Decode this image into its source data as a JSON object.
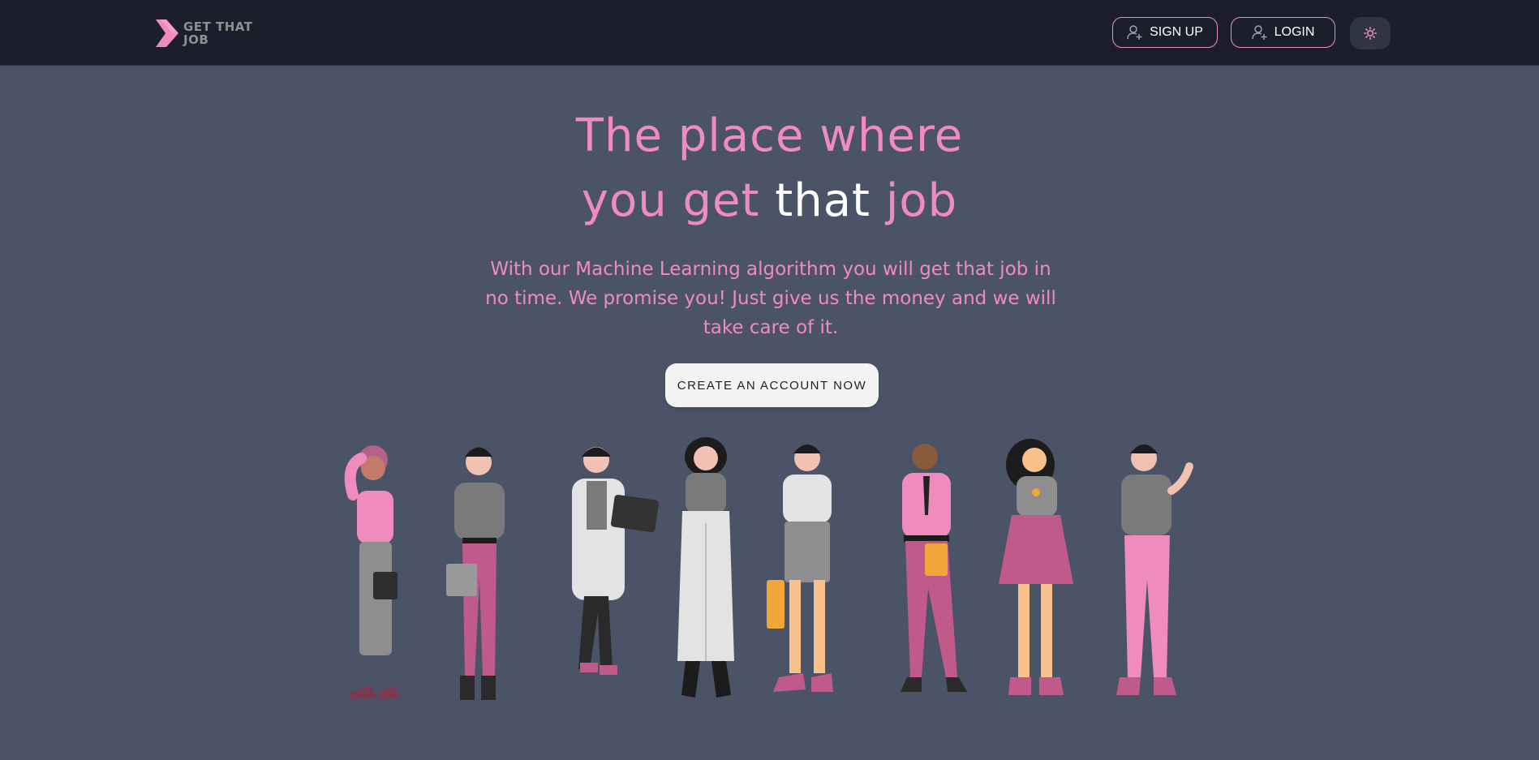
{
  "nav": {
    "logo_line1": "GET THAT",
    "logo_line2": "JOB",
    "signup_label": "SIGN UP",
    "login_label": "LOGIN",
    "theme_icon": "sun-icon"
  },
  "hero": {
    "title_line1": "The place where",
    "title_you_get": "you get",
    "title_that": "that",
    "title_job": "job",
    "description": "With our Machine Learning algorithm you will get that job in no time. We promise you! Just give us the money and we will take care of it.",
    "cta_label": "CREATE AN ACCOUNT NOW"
  },
  "colors": {
    "background": "#4b5366",
    "navbar": "#1c1f2b",
    "accent_pink": "#f08bbd"
  }
}
